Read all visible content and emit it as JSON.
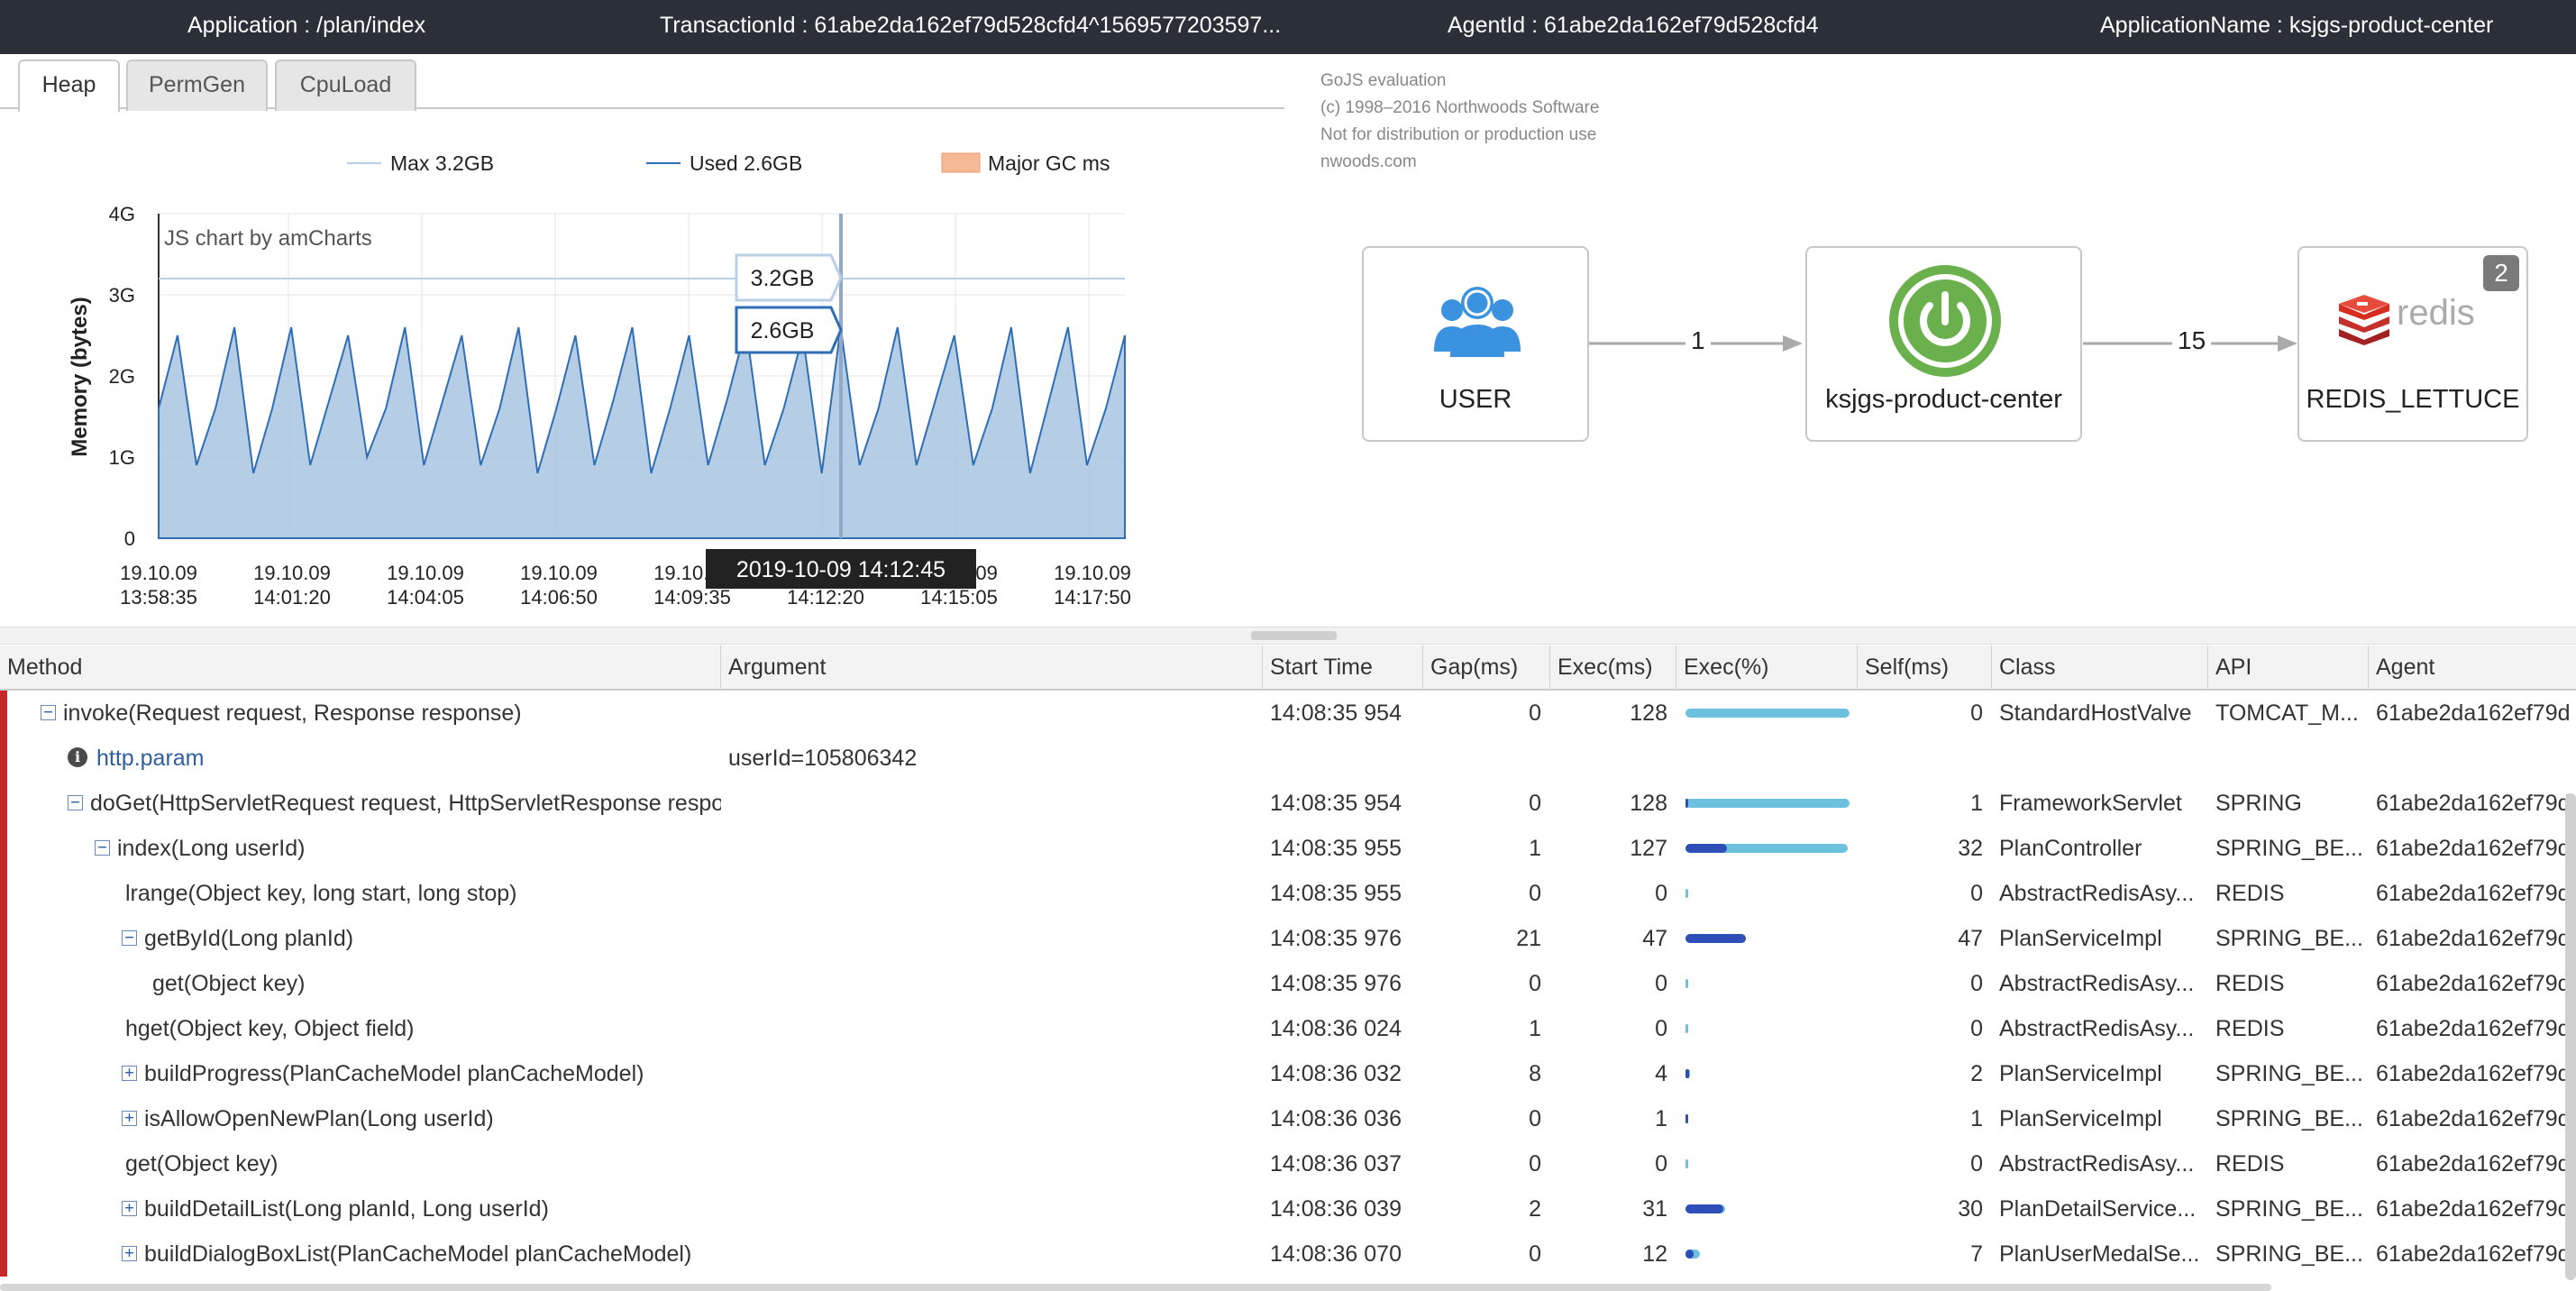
{
  "header": {
    "application": "Application : /plan/index",
    "transaction_id": "TransactionId : 61abe2da162ef79d528cfd4^1569577203597...",
    "agent_id": "AgentId : 61abe2da162ef79d528cfd4",
    "application_name": "ApplicationName : ksjgs-product-center"
  },
  "tabs": [
    {
      "label": "Heap",
      "active": true
    },
    {
      "label": "PermGen",
      "active": false
    },
    {
      "label": "CpuLoad",
      "active": false
    }
  ],
  "chart": {
    "watermark": "JS chart by amCharts",
    "legend": {
      "max": "Max 3.2GB",
      "used": "Used 2.6GB",
      "gc": "Major GC ms"
    },
    "ylabel": "Memory (bytes)",
    "yticks": [
      "0",
      "1G",
      "2G",
      "3G",
      "4G"
    ],
    "xticks": [
      {
        "date": "19.10.09",
        "time": "13:58:35"
      },
      {
        "date": "19.10.09",
        "time": "14:01:20"
      },
      {
        "date": "19.10.09",
        "time": "14:04:05"
      },
      {
        "date": "19.10.09",
        "time": "14:06:50"
      },
      {
        "date": "19.10.09",
        "time": "14:09:35"
      },
      {
        "date": "19.10.09",
        "time": "14:12:20"
      },
      {
        "date": "19.10.09",
        "time": "14:15:05"
      },
      {
        "date": "19.10.09",
        "time": "14:17:50"
      }
    ],
    "tooltip_max": "3.2GB",
    "tooltip_used": "2.6GB",
    "cursor_label": "2019-10-09 14:12:45",
    "colors": {
      "used_line": "#2f6db5",
      "used_fill": "#a9c4e2",
      "max_line": "#b9cfe6",
      "gc": "#f7b995"
    }
  },
  "chart_data": {
    "type": "area",
    "title": "",
    "xlabel": "",
    "ylabel": "Memory (bytes)",
    "ylim": [
      0,
      4
    ],
    "y_unit": "GB",
    "x_range": [
      "2019-10-09 13:58:35",
      "2019-10-09 14:19:00"
    ],
    "series": [
      {
        "name": "Max 3.2GB",
        "type": "line",
        "value": 3.2
      },
      {
        "name": "Used 2.6GB",
        "type": "area",
        "pattern": "sawtooth",
        "values": [
          1.6,
          2.5,
          0.9,
          1.6,
          2.6,
          0.8,
          1.6,
          2.6,
          0.9,
          1.7,
          2.5,
          1.0,
          1.6,
          2.6,
          0.9,
          1.7,
          2.5,
          0.9,
          1.6,
          2.6,
          0.8,
          1.6,
          2.5,
          0.9,
          1.7,
          2.6,
          0.8,
          1.6,
          2.5,
          0.9,
          1.7,
          2.6,
          0.9,
          1.6,
          2.5,
          0.8,
          2.6,
          0.9,
          1.6,
          2.6,
          0.9,
          1.7,
          2.5,
          0.9,
          1.6,
          2.6,
          0.8,
          1.7,
          2.6,
          0.9,
          1.6,
          2.5
        ]
      },
      {
        "name": "Major GC ms",
        "type": "bar",
        "values": []
      }
    ],
    "cursor": {
      "time": "2019-10-09 14:12:45",
      "max": "3.2GB",
      "used": "2.6GB"
    }
  },
  "servermap": {
    "notes": [
      "GoJS evaluation",
      "(c) 1998–2016 Northwoods Software",
      "Not for distribution or production use",
      "nwoods.com"
    ],
    "nodes": [
      {
        "label": "USER",
        "icon": "users-icon"
      },
      {
        "label": "ksjgs-product-center",
        "icon": "spring-power-icon"
      },
      {
        "label": "REDIS_LETTUCE",
        "icon": "redis-logo-icon",
        "badge": "2",
        "logo_text": "redis"
      }
    ],
    "edges": [
      {
        "label": "1"
      },
      {
        "label": "15"
      }
    ]
  },
  "grid": {
    "columns": [
      "Method",
      "Argument",
      "Start Time",
      "Gap(ms)",
      "Exec(ms)",
      "Exec(%)",
      "Self(ms)",
      "Class",
      "API",
      "Agent"
    ],
    "rows": [
      {
        "depth": 0,
        "toggle": "minus",
        "method": "invoke(Request request, Response response)",
        "argument": "",
        "start": "14:08:35 954",
        "gap": "0",
        "exec": "128",
        "exec_pct": 1.0,
        "self_pct": 0.0,
        "self": "0",
        "class": "StandardHostValve",
        "api": "TOMCAT_M...",
        "agent": "61abe2da162ef79d"
      },
      {
        "depth": 1,
        "toggle": "info",
        "method": "http.param",
        "argument": "userId=105806342",
        "start": "",
        "gap": "",
        "exec": "",
        "exec_pct": null,
        "self_pct": null,
        "self": "",
        "class": "",
        "api": "",
        "agent": ""
      },
      {
        "depth": 1,
        "toggle": "minus",
        "method": "doGet(HttpServletRequest request, HttpServletResponse response)",
        "argument": "",
        "start": "14:08:35 954",
        "gap": "0",
        "exec": "128",
        "exec_pct": 1.0,
        "self_pct": 0.01,
        "self": "1",
        "class": "FrameworkServlet",
        "api": "SPRING",
        "agent": "61abe2da162ef79d"
      },
      {
        "depth": 2,
        "toggle": "minus",
        "method": "index(Long userId)",
        "argument": "",
        "start": "14:08:35 955",
        "gap": "1",
        "exec": "127",
        "exec_pct": 0.99,
        "self_pct": 0.25,
        "self": "32",
        "class": "PlanController",
        "api": "SPRING_BE...",
        "agent": "61abe2da162ef79d"
      },
      {
        "depth": 3,
        "toggle": "none",
        "method": "lrange(Object key, long start, long stop)",
        "argument": "",
        "start": "14:08:35 955",
        "gap": "0",
        "exec": "0",
        "exec_pct": 0.0,
        "self_pct": 0.0,
        "self": "0",
        "class": "AbstractRedisAsy...",
        "api": "REDIS",
        "agent": "61abe2da162ef79d"
      },
      {
        "depth": 3,
        "toggle": "minus",
        "method": "getById(Long planId)",
        "argument": "",
        "start": "14:08:35 976",
        "gap": "21",
        "exec": "47",
        "exec_pct": 0.37,
        "self_pct": 0.37,
        "self": "47",
        "class": "PlanServiceImpl",
        "api": "SPRING_BE...",
        "agent": "61abe2da162ef79d"
      },
      {
        "depth": 4,
        "toggle": "none",
        "method": "get(Object key)",
        "argument": "",
        "start": "14:08:35 976",
        "gap": "0",
        "exec": "0",
        "exec_pct": 0.0,
        "self_pct": 0.0,
        "self": "0",
        "class": "AbstractRedisAsy...",
        "api": "REDIS",
        "agent": "61abe2da162ef79d"
      },
      {
        "depth": 3,
        "toggle": "none",
        "method": "hget(Object key, Object field)",
        "argument": "",
        "start": "14:08:36 024",
        "gap": "1",
        "exec": "0",
        "exec_pct": 0.0,
        "self_pct": 0.0,
        "self": "0",
        "class": "AbstractRedisAsy...",
        "api": "REDIS",
        "agent": "61abe2da162ef79d"
      },
      {
        "depth": 3,
        "toggle": "plus",
        "method": "buildProgress(PlanCacheModel planCacheModel)",
        "argument": "",
        "start": "14:08:36 032",
        "gap": "8",
        "exec": "4",
        "exec_pct": 0.03,
        "self_pct": 0.02,
        "self": "2",
        "class": "PlanServiceImpl",
        "api": "SPRING_BE...",
        "agent": "61abe2da162ef79d"
      },
      {
        "depth": 3,
        "toggle": "plus",
        "method": "isAllowOpenNewPlan(Long userId)",
        "argument": "",
        "start": "14:08:36 036",
        "gap": "0",
        "exec": "1",
        "exec_pct": 0.01,
        "self_pct": 0.01,
        "self": "1",
        "class": "PlanServiceImpl",
        "api": "SPRING_BE...",
        "agent": "61abe2da162ef79d"
      },
      {
        "depth": 3,
        "toggle": "none",
        "method": "get(Object key)",
        "argument": "",
        "start": "14:08:36 037",
        "gap": "0",
        "exec": "0",
        "exec_pct": 0.0,
        "self_pct": 0.0,
        "self": "0",
        "class": "AbstractRedisAsy...",
        "api": "REDIS",
        "agent": "61abe2da162ef79d"
      },
      {
        "depth": 3,
        "toggle": "plus",
        "method": "buildDetailList(Long planId, Long userId)",
        "argument": "",
        "start": "14:08:36 039",
        "gap": "2",
        "exec": "31",
        "exec_pct": 0.24,
        "self_pct": 0.23,
        "self": "30",
        "class": "PlanDetailService...",
        "api": "SPRING_BE...",
        "agent": "61abe2da162ef79d"
      },
      {
        "depth": 3,
        "toggle": "plus",
        "method": "buildDialogBoxList(PlanCacheModel planCacheModel)",
        "argument": "",
        "start": "14:08:36 070",
        "gap": "0",
        "exec": "12",
        "exec_pct": 0.09,
        "self_pct": 0.05,
        "self": "7",
        "class": "PlanUserMedalSe...",
        "api": "SPRING_BE...",
        "agent": "61abe2da162ef79d"
      }
    ]
  }
}
